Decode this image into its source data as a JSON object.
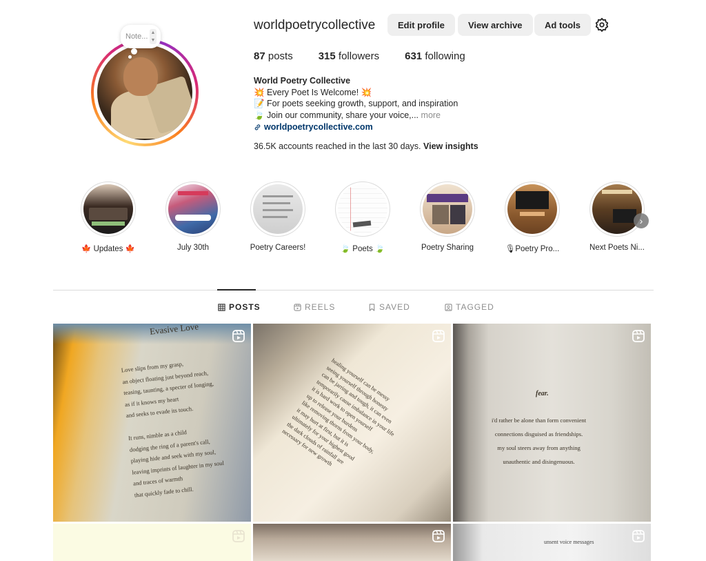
{
  "profile": {
    "note_placeholder": "Note...",
    "username": "worldpoetrycollective",
    "buttons": {
      "edit": "Edit profile",
      "archive": "View archive",
      "adtools": "Ad tools"
    },
    "stats": [
      {
        "count": "87",
        "label": "posts"
      },
      {
        "count": "315",
        "label": "followers"
      },
      {
        "count": "631",
        "label": "following"
      }
    ],
    "bio": {
      "name": "World Poetry Collective",
      "line1": "💥 Every Poet Is Welcome! 💥",
      "line2": "📝 For poets seeking growth, support, and inspiration",
      "line3": "🍃 Join our community, share your voice,...",
      "more": "more",
      "link": "worldpoetrycollective.com"
    },
    "insights_text": "36.5K accounts reached in the last 30 days.",
    "insights_link": "View insights"
  },
  "highlights": [
    {
      "label": "🍁 Updates 🍁",
      "theme": "updates"
    },
    {
      "label": "July 30th",
      "theme": "july"
    },
    {
      "label": "Poetry Careers!",
      "theme": "careers"
    },
    {
      "label": "🍃 Poets 🍃",
      "theme": "poets"
    },
    {
      "label": "Poetry Sharing",
      "theme": "sharing"
    },
    {
      "label": "🎙Poetry Pro...",
      "theme": "pro"
    },
    {
      "label": "Next Poets Ni...",
      "theme": "night"
    }
  ],
  "tabs": [
    {
      "label": "POSTS",
      "icon": "grid-icon",
      "active": true
    },
    {
      "label": "REELS",
      "icon": "reels-icon",
      "active": false
    },
    {
      "label": "SAVED",
      "icon": "bookmark-icon",
      "active": false
    },
    {
      "label": "TAGGED",
      "icon": "tagged-icon",
      "active": false
    }
  ],
  "posts": [
    {
      "title": "Evasive Love",
      "text": "Love slips from my grasp,\nan object floating just beyond reach,\nteasing, taunting, a specter of longing,\nas if it knows my heart\nand seeks to evade its touch.\n\nIt runs, nimble as a child\ndodging the ring of a parent's call,\nplaying hide and seek with my soul,\nleaving imprints of laughter in my soul\nand traces of warmth\nthat quickly fade to chill."
    },
    {
      "title": "",
      "text": "healing yourself can be messy\nseeing yourself through honesty\ncan be jarring and tough, it can even\ntemporarily cause imbalance in your life\nit is hard work to open yourself\nup to release your burdens\nlike removing thorns from your body,\nit may hurt at first, but it is\nultimately for your highest good\nthe dark clouds of rainfall are\nnecessary for new growth"
    },
    {
      "title": "fear.",
      "text": "i'd rather be alone than form convenient\nconnections disguised as friendships.\nmy soul steers away from anything\nunauthentic and disingenuous."
    },
    {
      "title": "",
      "text": ""
    },
    {
      "title": "",
      "text": ""
    },
    {
      "title": "unsent voice messages",
      "text": ""
    }
  ],
  "colors": {
    "link": "#00376b",
    "secondary_text": "#8e8e8e",
    "button_bg": "#efefef",
    "divider": "#dbdbdb"
  }
}
